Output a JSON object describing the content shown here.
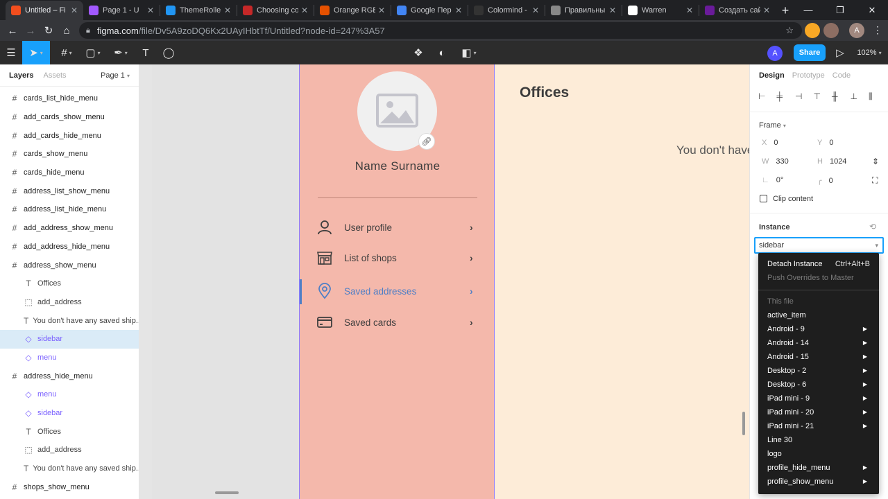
{
  "browser": {
    "tabs": [
      {
        "label": "Untitled – Fi",
        "color": "#f24e1e",
        "active": true
      },
      {
        "label": "Page 1 - U",
        "color": "#a259ff"
      },
      {
        "label": "ThemeRoller",
        "color": "#2196f3"
      },
      {
        "label": "Choosing co",
        "color": "#c62828"
      },
      {
        "label": "Orange RGB",
        "color": "#e65100"
      },
      {
        "label": "Google Пер",
        "color": "#4285f4"
      },
      {
        "label": "Colormind -",
        "color": "#333333"
      },
      {
        "label": "Правильны",
        "color": "#888888"
      },
      {
        "label": "Warren",
        "color": "#ffffff"
      },
      {
        "label": "Создать сай",
        "color": "#6a1b9a"
      }
    ],
    "new_tab": "+",
    "url_host": "figma.com",
    "url_path": "/file/Dv5A9zoDQ6Kx2UAyIHbtTf/Untitled?node-id=247%3A57",
    "profile_initial": "A"
  },
  "figma_toolbar": {
    "share_label": "Share",
    "zoom": "102%",
    "user_initial": "A"
  },
  "layers_panel": {
    "tab_layers": "Layers",
    "tab_assets": "Assets",
    "page": "Page 1",
    "items": [
      {
        "label": "cards_list_hide_menu",
        "type": "frame",
        "level": 1
      },
      {
        "label": "add_cards_show_menu",
        "type": "frame",
        "level": 1
      },
      {
        "label": "add_cards_hide_menu",
        "type": "frame",
        "level": 1
      },
      {
        "label": "cards_show_menu",
        "type": "frame",
        "level": 1
      },
      {
        "label": "cards_hide_menu",
        "type": "frame",
        "level": 1
      },
      {
        "label": "address_list_show_menu",
        "type": "frame",
        "level": 1
      },
      {
        "label": "address_list_hide_menu",
        "type": "frame",
        "level": 1
      },
      {
        "label": "add_address_show_menu",
        "type": "frame",
        "level": 1
      },
      {
        "label": "add_address_hide_menu",
        "type": "frame",
        "level": 1
      },
      {
        "label": "address_show_menu",
        "type": "frame",
        "level": 1
      },
      {
        "label": "Offices",
        "type": "text",
        "level": 2
      },
      {
        "label": "add_address",
        "type": "group",
        "level": 2
      },
      {
        "label": "You don't have any saved ship...",
        "type": "text",
        "level": 2
      },
      {
        "label": "sidebar",
        "type": "instance",
        "level": 2,
        "selected": true
      },
      {
        "label": "menu",
        "type": "instance",
        "level": 2
      },
      {
        "label": "address_hide_menu",
        "type": "frame",
        "level": 1
      },
      {
        "label": "menu",
        "type": "instance",
        "level": 2
      },
      {
        "label": "sidebar",
        "type": "instance",
        "level": 2
      },
      {
        "label": "Offices",
        "type": "text",
        "level": 2
      },
      {
        "label": "add_address",
        "type": "group",
        "level": 2
      },
      {
        "label": "You don't have any saved ship...",
        "type": "text",
        "level": 2
      },
      {
        "label": "shops_show_menu",
        "type": "frame",
        "level": 1
      }
    ]
  },
  "canvas": {
    "profile_name": "Name Surname",
    "menu": [
      {
        "label": "User profile",
        "icon": "user-icon",
        "active": false
      },
      {
        "label": "List of shops",
        "icon": "shop-icon",
        "active": false
      },
      {
        "label": "Saved addresses",
        "icon": "location-pin-icon",
        "active": true
      },
      {
        "label": "Saved cards",
        "icon": "credit-card-icon",
        "active": false
      }
    ],
    "offices_title": "Offices",
    "empty_message": "You don't have any saved shipping addresses"
  },
  "design_panel": {
    "tab_design": "Design",
    "tab_prototype": "Prototype",
    "tab_code": "Code",
    "frame_label": "Frame",
    "x_label": "X",
    "x": "0",
    "y_label": "Y",
    "y": "0",
    "w_label": "W",
    "w": "330",
    "h_label": "H",
    "h": "1024",
    "rotation": "0°",
    "radius": "0",
    "clip_content": "Clip content",
    "instance_label": "Instance",
    "instance_value": "sidebar"
  },
  "instance_dropdown": {
    "detach": "Detach Instance",
    "detach_shortcut": "Ctrl+Alt+B",
    "push": "Push Overrides to Master",
    "this_file": "This file",
    "items": [
      {
        "label": "active_item",
        "sub": false
      },
      {
        "label": "Android - 9",
        "sub": true
      },
      {
        "label": "Android - 14",
        "sub": true
      },
      {
        "label": "Android - 15",
        "sub": true
      },
      {
        "label": "Desktop - 2",
        "sub": true
      },
      {
        "label": "Desktop - 6",
        "sub": true
      },
      {
        "label": "iPad mini - 9",
        "sub": true
      },
      {
        "label": "iPad mini - 20",
        "sub": true
      },
      {
        "label": "iPad mini - 21",
        "sub": true
      },
      {
        "label": "Line 30",
        "sub": false
      },
      {
        "label": "logo",
        "sub": false
      },
      {
        "label": "profile_hide_menu",
        "sub": true
      },
      {
        "label": "profile_show_menu",
        "sub": true
      }
    ]
  },
  "colors": {
    "accent": "#18a0fb",
    "sidebar_bg": "#f4b8ab",
    "content_bg": "#fdecd8",
    "active_item": "#4f7fc6",
    "component": "#7b61ff"
  }
}
